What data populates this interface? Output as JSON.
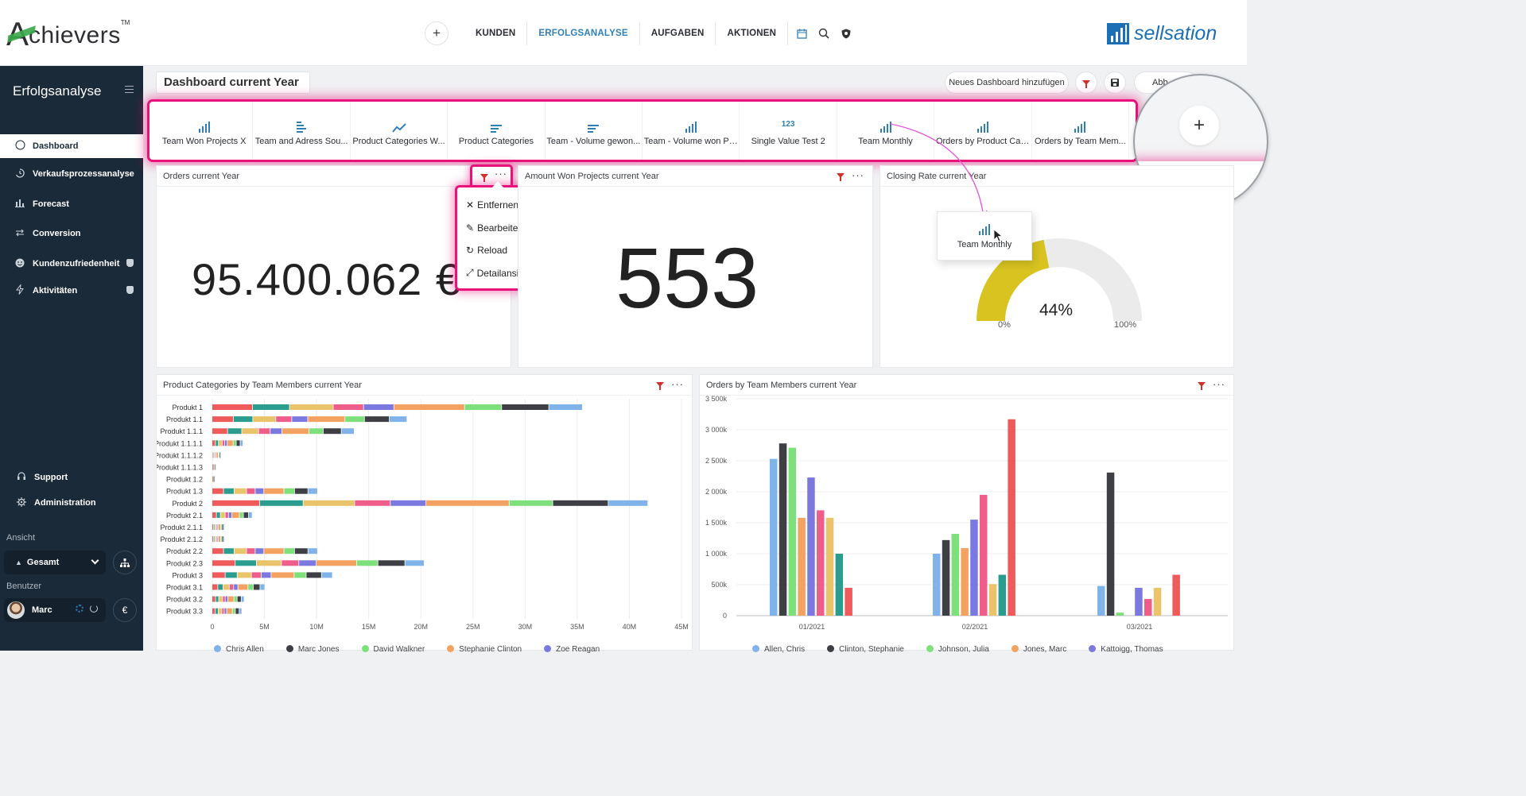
{
  "header": {
    "logo_text": "chievers",
    "logo_initial": "A",
    "logo_tm": "TM",
    "nav": [
      "KUNDEN",
      "ERFOLGSANALYSE",
      "AUFGABEN",
      "AKTIONEN"
    ],
    "active_nav": "ERFOLGSANALYSE",
    "plus_label": "+",
    "brand_text": "sellsation",
    "accent": "#2f7fb6",
    "highlight": "#e8127a"
  },
  "sidebar": {
    "title": "Erfolgsanalyse",
    "items": [
      {
        "label": "Dashboard",
        "icon": "circle-icon"
      },
      {
        "label": "Verkaufsprozessanalyse",
        "icon": "funnel-icon"
      },
      {
        "label": "Forecast",
        "icon": "bar-chart-icon"
      },
      {
        "label": "Conversion",
        "icon": "conversion-icon"
      },
      {
        "label": "Kundenzufriedenheit",
        "icon": "smiley-icon"
      },
      {
        "label": "Aktivitäten",
        "icon": "lightning-icon"
      }
    ],
    "support": "Support",
    "administration": "Administration",
    "view_label": "Ansicht",
    "view_value": "Gesamt",
    "user_label": "Benutzer",
    "user_name": "Marc",
    "currency": "€"
  },
  "toolbar": {
    "dashboard_title": "Dashboard current Year",
    "add_dashboard": "Neues Dashboard hinzufügen",
    "abbr_button": "Abb"
  },
  "widgets": [
    {
      "label": "Team Won Projects X",
      "icon": "bar"
    },
    {
      "label": "Team and Adress Sou...",
      "icon": "stack"
    },
    {
      "label": "Product Categories W...",
      "icon": "line"
    },
    {
      "label": "Product Categories",
      "icon": "hbar"
    },
    {
      "label": "Team - Volume gewon...",
      "icon": "hbar"
    },
    {
      "label": "Team - Volume won Pr...",
      "icon": "bar"
    },
    {
      "label": "Single Value Test 2",
      "icon": "num"
    },
    {
      "label": "Team Monthly",
      "icon": "bar"
    },
    {
      "label": "Orders by Product Cat...",
      "icon": "bar"
    },
    {
      "label": "Orders by Team Mem...",
      "icon": "bar"
    }
  ],
  "widget_num_icon": "123",
  "magnifier_plus": "+",
  "panels": {
    "orders": {
      "title": "Orders current Year",
      "value": "95.400.062 €"
    },
    "amount": {
      "title": "Amount Won Projects current Year",
      "value": "553"
    },
    "closing": {
      "title": "Closing Rate current Year",
      "value": "44%",
      "min": "0%",
      "max": "100%",
      "percent": 44
    },
    "product_cat": {
      "title": "Product Categories by Team Members current Year"
    },
    "orders_team": {
      "title": "Orders by Team Members current Year"
    }
  },
  "context_menu": [
    "Entfernen",
    "Bearbeiten",
    "Reload",
    "Detailansicht"
  ],
  "drag_tile": {
    "label": "Team Monthly"
  },
  "chart_data": [
    {
      "type": "bar",
      "orientation": "horizontal",
      "stacked": true,
      "title": "Product Categories by Team Members current Year",
      "categories": [
        "Produkt 1",
        "Produkt 1.1",
        "Produkt 1.1.1",
        "Produkt 1.1.1.1",
        "Produkt 1.1.1.2",
        "Produkt 1.1.1.3",
        "Produkt 1.2",
        "Produkt 1.3",
        "Produkt 2",
        "Produkt 2.1",
        "Produkt 2.1.1",
        "Produkt 2.1.2",
        "Produkt 2.2",
        "Produkt 2.3",
        "Produkt 3",
        "Produkt 3.1",
        "Produkt 3.2",
        "Produkt 3.3"
      ],
      "xticks": [
        "0",
        "5M",
        "10M",
        "15M",
        "20M",
        "25M",
        "30M",
        "35M",
        "40M",
        "45M"
      ],
      "xlim": [
        0,
        45000000
      ],
      "totals": [
        32300000,
        17000000,
        12400000,
        2700000,
        800000,
        300000,
        200000,
        9200000,
        38000000,
        3500000,
        1100000,
        1100000,
        9200000,
        18500000,
        10500000,
        4600000,
        2800000,
        2600000
      ],
      "palette": [
        "#ef5b5b",
        "#2a9d8f",
        "#e9c46a",
        "#ef5d8a",
        "#7b79e0",
        "#f4a261",
        "#7de07a",
        "#3d3f45",
        "#7fb3ea"
      ],
      "legend": [
        {
          "name": "Chris Allen",
          "color": "#7fb3ea"
        },
        {
          "name": "Marc Jones",
          "color": "#3d3f45"
        },
        {
          "name": "David Walkner",
          "color": "#7de07a"
        },
        {
          "name": "Stephanie Clinton",
          "color": "#f4a261"
        },
        {
          "name": "Zoe Reagan",
          "color": "#7b79e0"
        }
      ]
    },
    {
      "type": "bar",
      "title": "Orders by Team Members current Year",
      "categories": [
        "01/2021",
        "02/2021",
        "03/2021"
      ],
      "yticks": [
        "0",
        "500k",
        "1 000k",
        "1 500k",
        "2 000k",
        "2 500k",
        "3 000k",
        "3 500k"
      ],
      "ylim": [
        0,
        3500000
      ],
      "series": [
        {
          "name": "Allen, Chris",
          "color": "#7fb3ea",
          "values": [
            2530000,
            1000000,
            480000
          ]
        },
        {
          "name": "Clinton, Stephanie",
          "color": "#3d3f45",
          "values": [
            2780000,
            1220000,
            2310000
          ]
        },
        {
          "name": "Johnson, Julia",
          "color": "#7de07a",
          "values": [
            2710000,
            1320000,
            50000
          ]
        },
        {
          "name": "Jones, Marc",
          "color": "#f4a261",
          "values": [
            1580000,
            1090000,
            0
          ]
        },
        {
          "name": "Kattoigg, Thomas",
          "color": "#7b79e0",
          "values": [
            2230000,
            1550000,
            450000
          ]
        },
        {
          "name": "",
          "color": "#ef5d8a",
          "values": [
            1700000,
            1950000,
            270000
          ]
        },
        {
          "name": "",
          "color": "#e9c46a",
          "values": [
            1580000,
            510000,
            450000
          ]
        },
        {
          "name": "",
          "color": "#2a9d8f",
          "values": [
            1000000,
            660000,
            0
          ]
        },
        {
          "name": "",
          "color": "#ef5b5b",
          "values": [
            450000,
            3170000,
            660000
          ]
        }
      ]
    }
  ]
}
